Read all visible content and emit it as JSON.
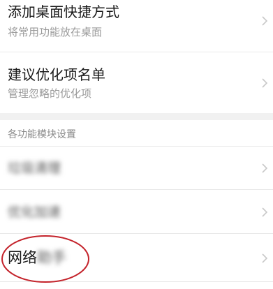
{
  "shortcut": {
    "title": "添加桌面快捷方式",
    "subtitle": "将常用功能放在桌面"
  },
  "whitelist": {
    "title": "建议优化项名单",
    "subtitle": "管理忽略的优化项"
  },
  "modules": {
    "header": "各功能模块设置",
    "items": [
      {
        "label": "垃圾清理"
      },
      {
        "label": "优化加速"
      },
      {
        "label_visible": "网络",
        "label_blurred": "助手"
      }
    ]
  },
  "colors": {
    "highlight_circle": "#c4232b",
    "chevron": "#c8c8c8",
    "section_background": "#f1f1f1"
  }
}
